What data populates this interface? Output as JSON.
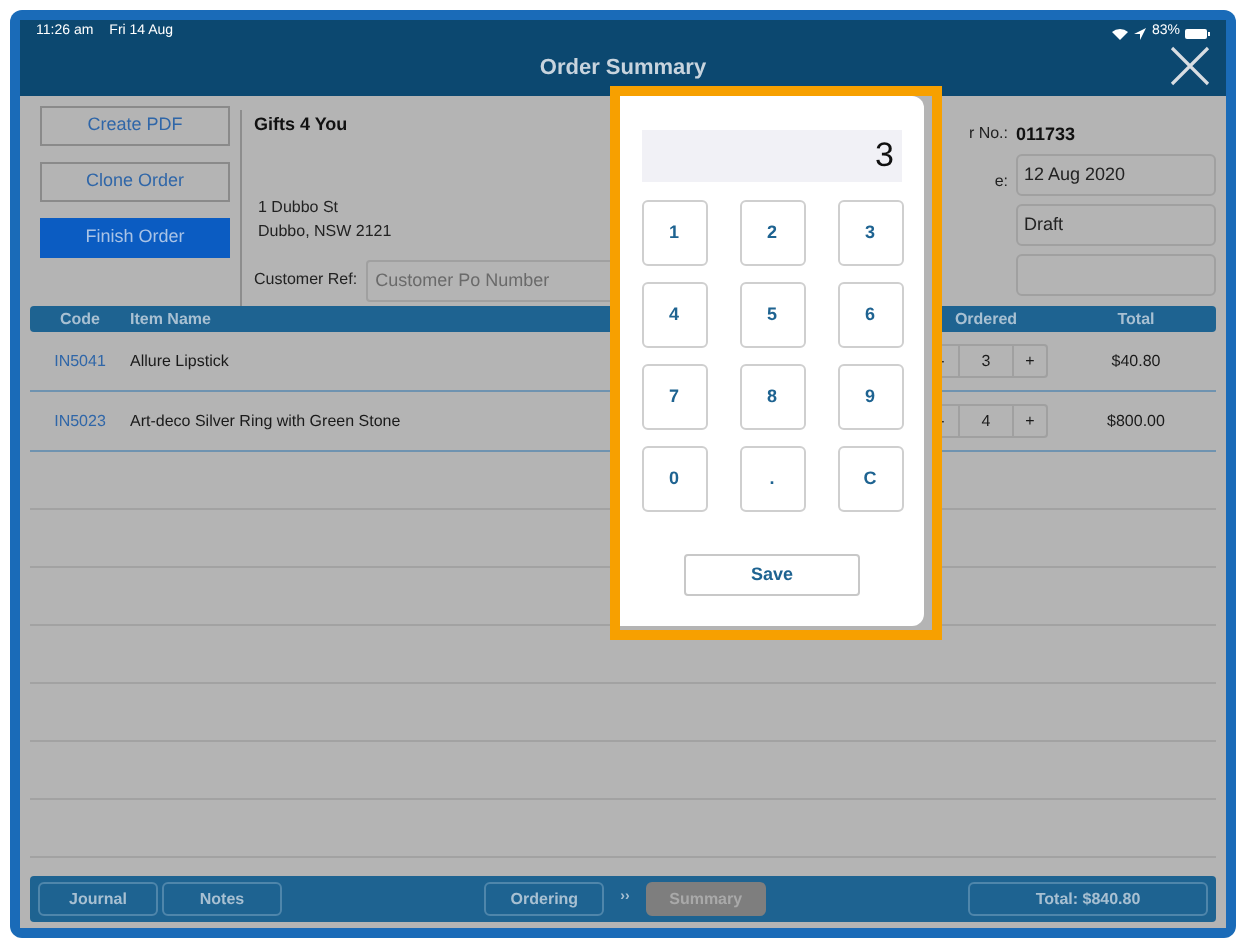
{
  "status_bar": {
    "time": "11:26 am",
    "date": "Fri 14 Aug",
    "battery": "83%"
  },
  "window": {
    "title": "Order Summary"
  },
  "actions": [
    {
      "label": "Create PDF",
      "kind": "outline"
    },
    {
      "label": "Clone Order",
      "kind": "outline"
    },
    {
      "label": "Finish Order",
      "kind": "primary"
    }
  ],
  "customer": {
    "name": "Gifts 4 You",
    "address": [
      "1 Dubbo St",
      "Dubbo, NSW 2121"
    ],
    "ref_label": "Customer Ref:",
    "ref_placeholder": "Customer Po Number"
  },
  "order": {
    "number_label": "r No.:",
    "number": "011733",
    "date_label": "e:",
    "date": "12 Aug 2020",
    "status": "Draft"
  },
  "table": {
    "columns": [
      "Code",
      "Item Name",
      "Ordered",
      "Total"
    ],
    "rows": [
      {
        "code": "IN5041",
        "name": "Allure Lipstick",
        "minus": "-",
        "qty": "3",
        "plus": "+",
        "total": "$40.80"
      },
      {
        "code": "IN5023",
        "name": "Art-deco Silver Ring with Green Stone",
        "minus": "-",
        "qty": "4",
        "plus": "+",
        "total": "$800.00"
      }
    ]
  },
  "footer": {
    "buttons": [
      "Journal",
      "Notes"
    ],
    "steps": [
      {
        "label": "Ordering",
        "selected": false
      },
      {
        "label": "Summary",
        "selected": true
      }
    ],
    "separator": "››",
    "total": "Total: $840.80"
  },
  "keypad": {
    "display": "3",
    "keys": [
      "1",
      "2",
      "3",
      "4",
      "5",
      "6",
      "7",
      "8",
      "9",
      "0",
      ".",
      "C"
    ],
    "save": "Save"
  }
}
